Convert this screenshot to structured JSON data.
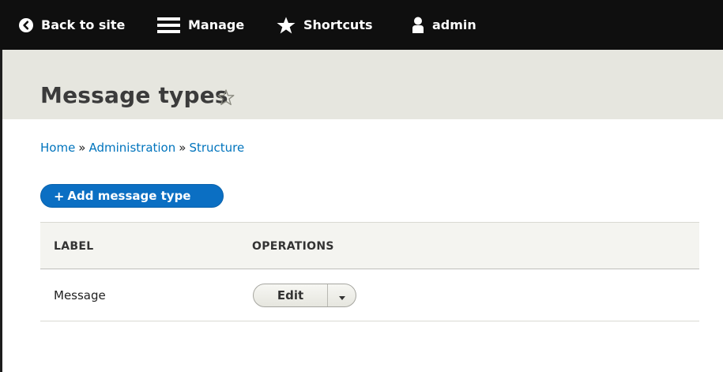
{
  "toolbar": {
    "back_label": "Back to site",
    "manage_label": "Manage",
    "shortcuts_label": "Shortcuts",
    "user_label": "admin",
    "icons": [
      "chevron-left-circle-icon",
      "hamburger-menu-icon",
      "star-icon",
      "user-icon"
    ]
  },
  "page": {
    "title": "Message types"
  },
  "breadcrumb": {
    "items": [
      "Home",
      "Administration",
      "Structure"
    ],
    "separator": "»"
  },
  "actions": {
    "add_label": "Add message type",
    "add_prefix": "+"
  },
  "table": {
    "columns": [
      "LABEL",
      "OPERATIONS"
    ],
    "rows": [
      {
        "label": "Message",
        "operation": "Edit"
      }
    ]
  },
  "colors": {
    "toolbar_bg": "#0f0f0f",
    "header_bg": "#e6e6df",
    "link": "#0074bd",
    "primary_button": "#0b6fc3"
  }
}
